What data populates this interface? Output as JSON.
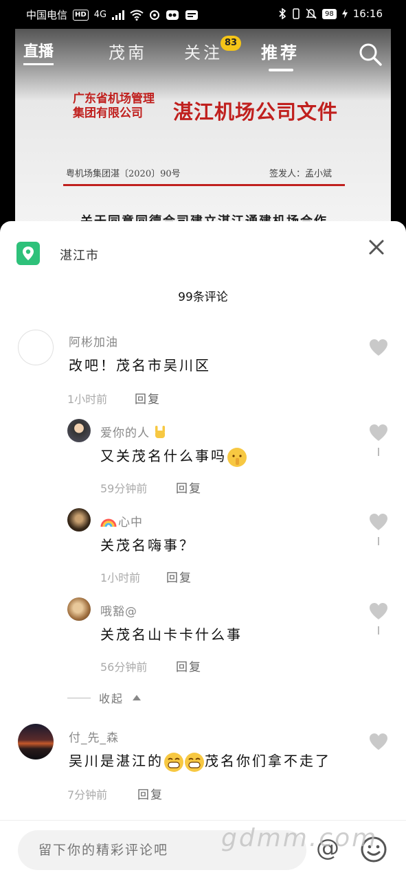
{
  "status_bar": {
    "carrier": "中国电信",
    "hd": "HD",
    "net": "4G",
    "battery": "98",
    "time": "16:16"
  },
  "top_nav": {
    "live": "直播",
    "tabs": [
      "茂南",
      "关注",
      "推荐"
    ],
    "active_tab": "推荐",
    "follow_badge": "83"
  },
  "video_doc": {
    "org_line1": "广东省机场管理",
    "org_line2": "集团有限公司",
    "title": "湛江机场公司文件",
    "doc_number": "粤机场集团湛〔2020〕90号",
    "signer": "签发人：孟小斌",
    "cut_text": "关于同意同德合司建立湛江通建机场合作"
  },
  "sheet": {
    "location": "湛江市",
    "comment_count": "99条评论"
  },
  "comments": [
    {
      "user": "阿彬加油",
      "text": "改吧！茂名市吴川区",
      "time": "1小时前",
      "reply": "回复"
    },
    {
      "user": "爱你的人",
      "text": "又关茂名什么事吗",
      "time": "59分钟前",
      "reply": "回复"
    },
    {
      "user": "心中",
      "text": "关茂名嗨事？",
      "time": "1小时前",
      "reply": "回复"
    },
    {
      "user": "哦豁@",
      "text": "关茂名山卡卡什么事",
      "time": "56分钟前",
      "reply": "回复"
    },
    {
      "user": "付_先_森",
      "text_before": "吴川是湛江的",
      "text_after": "茂名你们拿不走了",
      "time": "7分钟前",
      "reply": "回复"
    }
  ],
  "collapse_label": "收起",
  "input": {
    "placeholder": "留下你的精彩评论吧",
    "at": "@"
  },
  "watermark": "gdmm.com",
  "colors": {
    "doc_red": "#c0201e",
    "location_green": "#2ec17a",
    "badge_yellow": "#f5c518"
  }
}
